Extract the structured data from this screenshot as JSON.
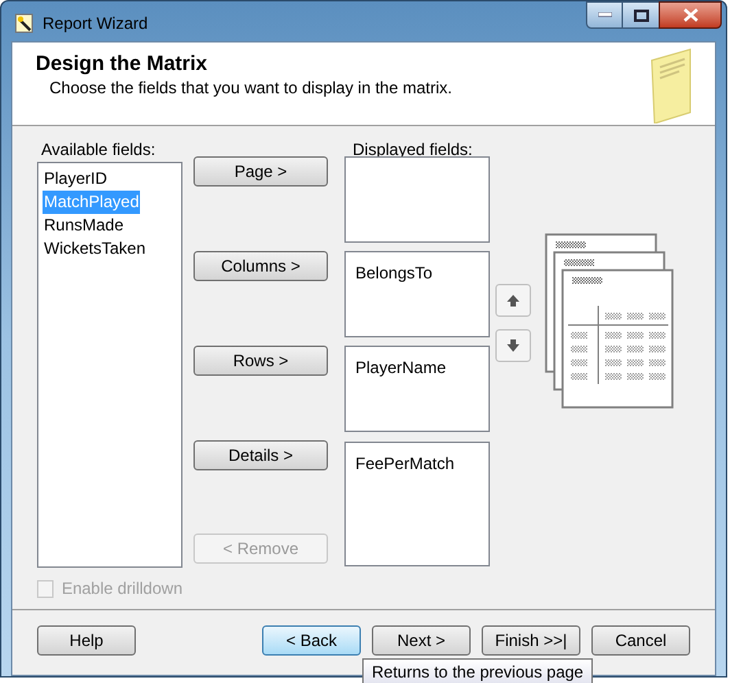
{
  "window": {
    "title": "Report Wizard"
  },
  "header": {
    "title": "Design the Matrix",
    "subtitle": "Choose the fields that you want to display in the matrix."
  },
  "available": {
    "label": "Available fields:",
    "items": [
      {
        "text": "PlayerID",
        "selected": false
      },
      {
        "text": "MatchPlayed",
        "selected": true
      },
      {
        "text": "RunsMade",
        "selected": false
      },
      {
        "text": "WicketsTaken",
        "selected": false
      }
    ]
  },
  "move_buttons": [
    {
      "label": "Page >",
      "disabled": false
    },
    {
      "label": "Columns >",
      "disabled": false
    },
    {
      "label": "Rows >",
      "disabled": false
    },
    {
      "label": "Details >",
      "disabled": false
    }
  ],
  "remove_button": {
    "label": "< Remove",
    "disabled": true
  },
  "displayed": {
    "label": "Displayed fields:",
    "groups": [
      {
        "kind": "empty"
      },
      {
        "kind": "list",
        "items": [
          "BelongsTo"
        ]
      },
      {
        "kind": "list",
        "items": [
          "PlayerName"
        ]
      },
      {
        "kind": "list",
        "items": [
          "FeePerMatch"
        ]
      }
    ]
  },
  "drilldown": {
    "label": "Enable drilldown",
    "checked": false,
    "disabled": true
  },
  "footer": {
    "buttons": [
      {
        "label": "Help",
        "focused": false
      },
      {
        "label": "< Back",
        "focused": true
      },
      {
        "label": "Next >",
        "focused": false
      },
      {
        "label": "Finish >>|",
        "focused": false
      },
      {
        "label": "Cancel",
        "focused": false
      }
    ]
  },
  "tooltip": {
    "text": "Returns to the previous page"
  }
}
